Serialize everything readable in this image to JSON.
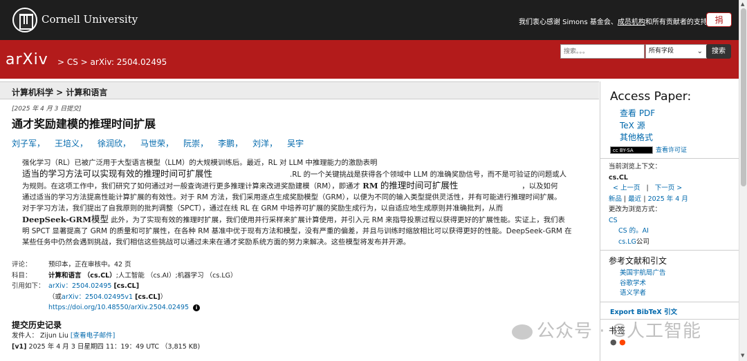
{
  "top_bar": {
    "university": "Cornell University",
    "thanks_prefix": "我们衷心感谢 Simons 基金会、",
    "thanks_link": "成员机构",
    "thanks_suffix": "和所有贡献者的支持。",
    "donate_label": "捐"
  },
  "header": {
    "logo": "arXiv",
    "breadcrumb": "> CS > arXiv: 2504.02495",
    "search_placeholder": "搜索。。。",
    "search_field": "所有字段",
    "search_button": "搜索",
    "help": "帮助",
    "advanced": "高级搜索"
  },
  "subheader": "计算机科学 > 计算和语言",
  "paper": {
    "submitted": "[2025 年 4 月 3 日提交]",
    "title": "通才奖励建模的推理时间扩展",
    "authors": [
      "刘子军，",
      "王培义，",
      "徐润欣，",
      "马世荣，",
      "阮崇，",
      "李鹏，",
      "刘洋，",
      "吴宇"
    ],
    "abstract": {
      "p1": "强化学习（RL）已被广泛用于大型语言模型（LLM）的大规模训练后。最近，RL 对 LLM 中推理能力的激励表明",
      "p2_big": "适当的学习方法可以实现有效的推理时间可扩展性",
      "p2_rest": ".RL 的一个关键挑战是获得各个领域中 LLM 的准确奖励信号，而不是可验证的问题或人",
      "p3a": "为规则。在这项工作中，我们研究了如何通过对一般查询进行更多推理计算来改进奖励建模（RM），即通才",
      "p3_bold": "RM",
      "p3b": "的推理时间可扩展性",
      "p3c": "，以及如何",
      "p4": "通过适当的学习方法提高性能计算扩展的有效性。对于 RM 方法，我们采用逐点生成奖励模型（GRM），以便为不同的输入类型提供灵活性，并有可能进行推理时间扩展。",
      "p5": "对于学习方法，我们提出了自我原则的批判调整（SPCT），通过在线 RL 在 GRM 中培养可扩展的奖励生成行为，以自适应地生成原则并准确批判，从而",
      "p6_bold": "DeepSeek-GRM",
      "p6_big": "模型",
      "p6_rest": "此外，为了实现有效的推理时扩展，我们使用并行采样来扩展计算使用，并引入元 RM 来指导投票过程以获得更好的扩展性能。实证上，我们表",
      "p7": "明 SPCT 显著提高了 GRM 的质量和可扩展性，在各种 RM 基准中优于现有方法和模型，没有严重的偏差，并且与训练时缩放相比可以获得更好的性能。DeepSeek-GRM 在",
      "p8": "某些任务中仍然会遇到挑战，我们相信这些挑战可以通过未来在通才奖励系统方面的努力来解决。这些模型将发布并开源。"
    },
    "meta": {
      "comment_label": "评论：",
      "comment": "预印本，正在审核中。42 页",
      "subject_label": "科目：",
      "subject_main": "计算和语言 （cs.CL）",
      "subject_rest": ";人工智能 （cs.AI）;机器学习 （cs.LG）",
      "cite_label": "引用如下：",
      "cite_id": "arXiv：2504.02495",
      "cite_tag": "[cs.CL]",
      "cite_or": "（或",
      "cite_v1": "arXiv：2504.02495v1",
      "cite_v1_tag": "[cs.CL]",
      "cite_close": "）",
      "doi": "https://doi.org/10.48550/arXiv.2504.02495",
      "info_icon": "i"
    },
    "history": {
      "title": "提交历史记录",
      "from_label": "发件人：",
      "from_name": "Zijun Liu",
      "email_link": "[查看电子邮件]",
      "v1_tag": "[v1]",
      "v1_text": "2025 年 4 月 3 日星期四 11：19：49 UTC （3,815 KB)"
    }
  },
  "sidebar": {
    "access_title": "Access Paper:",
    "links": [
      "查看 PDF",
      "TeX 源",
      "其他格式"
    ],
    "cc_badge": "cc BY-SA",
    "license": "查看许可证",
    "browse_context_label": "当前浏览上下文：",
    "browse_context": "cs.CL",
    "prev": "< 上一页",
    "next": "下一页 >",
    "nav_sep": "|",
    "new": "新品",
    "recent": "最近",
    "month": "2025 年 4 月",
    "change_context": "更改为浏览方式：",
    "ctx_cs": "CS",
    "ctx_ai": "CS 的。AI",
    "ctx_lg_link": "cs.LG",
    "ctx_lg_suffix": "公司",
    "refs_title": "参考文献和引文",
    "refs": [
      "美国宇航局广告",
      "谷歌学术",
      "语义学者"
    ],
    "bibtex": "Export BibTeX 引文",
    "bookmarks": "书签"
  },
  "watermark": "公众号 · G人工智能"
}
